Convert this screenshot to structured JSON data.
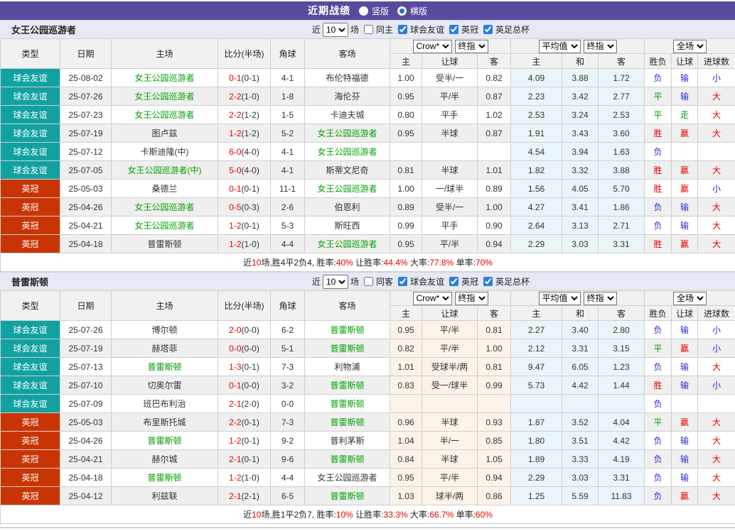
{
  "header": {
    "title": "近期战绩",
    "radios": [
      {
        "label": "竖版",
        "selected": false
      },
      {
        "label": "横版",
        "selected": true
      }
    ]
  },
  "table_header": {
    "cols": [
      "类型",
      "日期",
      "主场",
      "比分(半场)",
      "角球",
      "客场"
    ],
    "group1": {
      "dropdowns": [
        "Crow*",
        "终指"
      ],
      "subcols": [
        "主",
        "让球",
        "客"
      ]
    },
    "group2": {
      "dropdowns": [
        "平均值",
        "终指"
      ],
      "subcols": [
        "主",
        "和",
        "客"
      ]
    },
    "group3": {
      "dropdowns": [
        "全场"
      ],
      "subcols": [
        "胜负",
        "让球",
        "进球数"
      ]
    }
  },
  "colors": {
    "accent_purple": "#5a4a9d",
    "type_friendly": "#12a1a1",
    "type_championship": "#c93502",
    "focal_team_green": "#00a000",
    "score_red": "#e60000",
    "result_red": "#e60000",
    "result_blue": "#2c2cd8",
    "result_green": "#089b08",
    "avg_col_bg": "#eaf5fa",
    "crow_col_bg": "#fcf2e8"
  },
  "sections": [
    {
      "team": "女王公园巡游者",
      "crow_tint": false,
      "filter": {
        "near_label": "近",
        "count": "10",
        "games_label": "场",
        "same_label": "同主",
        "same_checked": false,
        "leagues": [
          {
            "label": "球会友谊",
            "checked": true
          },
          {
            "label": "英冠",
            "checked": true
          },
          {
            "label": "英足总杯",
            "checked": true
          }
        ]
      },
      "rows": [
        [
          "球会友谊",
          "25-08-02",
          "女王公园巡游者",
          1,
          "0-1",
          "(0-1)",
          "4-1",
          "布伦特福德",
          0,
          "1.00",
          "受半/一",
          "0.82",
          "4.09",
          "3.88",
          "1.72",
          "负",
          "输",
          "小"
        ],
        [
          "球会友谊",
          "25-07-26",
          "女王公园巡游者",
          1,
          "2-2",
          "(1-0)",
          "1-8",
          "海伦芬",
          0,
          "0.95",
          "平/半",
          "0.87",
          "2.23",
          "3.42",
          "2.77",
          "平",
          "输",
          "大"
        ],
        [
          "球会友谊",
          "25-07-23",
          "女王公园巡游者",
          1,
          "2-2",
          "(1-2)",
          "1-5",
          "卡迪夫城",
          0,
          "0.80",
          "平手",
          "1.02",
          "2.53",
          "3.24",
          "2.53",
          "平",
          "走",
          "大"
        ],
        [
          "球会友谊",
          "25-07-19",
          "图卢兹",
          0,
          "1-2",
          "(1-2)",
          "5-2",
          "女王公园巡游者",
          1,
          "0.95",
          "半球",
          "0.87",
          "1.91",
          "3.43",
          "3.60",
          "胜",
          "赢",
          "大"
        ],
        [
          "球会友谊",
          "25-07-12",
          "卡斯迪隆(中)",
          0,
          "6-0",
          "(4-0)",
          "4-1",
          "女王公园巡游者",
          1,
          "",
          "",
          "",
          "4.54",
          "3.94",
          "1.63",
          "负",
          "",
          ""
        ],
        [
          "球会友谊",
          "25-07-05",
          "女王公园巡游者(中)",
          1,
          "5-0",
          "(4-0)",
          "4-1",
          "斯蒂文尼奇",
          0,
          "0.81",
          "半球",
          "1.01",
          "1.82",
          "3.32",
          "3.88",
          "胜",
          "赢",
          "大"
        ],
        [
          "英冠",
          "25-05-03",
          "桑德兰",
          0,
          "0-1",
          "(0-1)",
          "11-1",
          "女王公园巡游者",
          1,
          "1.00",
          "一/球半",
          "0.89",
          "1.56",
          "4.05",
          "5.70",
          "胜",
          "赢",
          "小"
        ],
        [
          "英冠",
          "25-04-26",
          "女王公园巡游者",
          1,
          "0-5",
          "(0-3)",
          "2-6",
          "伯恩利",
          0,
          "0.89",
          "受半/一",
          "1.00",
          "4.27",
          "3.41",
          "1.86",
          "负",
          "输",
          "大"
        ],
        [
          "英冠",
          "25-04-21",
          "女王公园巡游者",
          1,
          "1-2",
          "(0-1)",
          "5-3",
          "斯旺西",
          0,
          "0.99",
          "平手",
          "0.90",
          "2.64",
          "3.13",
          "2.71",
          "负",
          "输",
          "大"
        ],
        [
          "英冠",
          "25-04-18",
          "普雷斯顿",
          0,
          "1-2",
          "(1-0)",
          "4-4",
          "女王公园巡游者",
          1,
          "0.95",
          "平/半",
          "0.94",
          "2.29",
          "3.03",
          "3.31",
          "胜",
          "赢",
          "大"
        ]
      ],
      "summary": [
        {
          "text": "近"
        },
        {
          "text": "10",
          "red": true
        },
        {
          "text": "场,胜4平2负4, 胜率:"
        },
        {
          "text": "40%",
          "red": true
        },
        {
          "text": " 让胜率:"
        },
        {
          "text": "44.4%",
          "red": true
        },
        {
          "text": " 大率:"
        },
        {
          "text": "77.8%",
          "red": true
        },
        {
          "text": " 单率:"
        },
        {
          "text": "70%",
          "red": true
        }
      ]
    },
    {
      "team": "普雷斯顿",
      "crow_tint": true,
      "filter": {
        "near_label": "近",
        "count": "10",
        "games_label": "场",
        "same_label": "同客",
        "same_checked": false,
        "leagues": [
          {
            "label": "球会友谊",
            "checked": true
          },
          {
            "label": "英冠",
            "checked": true
          },
          {
            "label": "英足总杯",
            "checked": true
          }
        ]
      },
      "rows": [
        [
          "球会友谊",
          "25-07-26",
          "博尔顿",
          0,
          "2-0",
          "(0-0)",
          "6-2",
          "普雷斯顿",
          1,
          "0.95",
          "平/半",
          "0.81",
          "2.27",
          "3.40",
          "2.80",
          "负",
          "输",
          "小"
        ],
        [
          "球会友谊",
          "25-07-19",
          "赫塔菲",
          0,
          "0-0",
          "(0-0)",
          "5-1",
          "普雷斯顿",
          1,
          "0.82",
          "平/半",
          "1.00",
          "2.12",
          "3.31",
          "3.15",
          "平",
          "赢",
          "小"
        ],
        [
          "球会友谊",
          "25-07-13",
          "普雷斯顿",
          1,
          "1-3",
          "(0-1)",
          "7-3",
          "利物浦",
          0,
          "1.01",
          "受球半/两",
          "0.81",
          "9.47",
          "6.05",
          "1.23",
          "负",
          "输",
          "大"
        ],
        [
          "球会友谊",
          "25-07-10",
          "切奥尔雷",
          0,
          "0-1",
          "(0-0)",
          "3-2",
          "普雷斯顿",
          1,
          "0.83",
          "受一/球半",
          "0.99",
          "5.73",
          "4.42",
          "1.44",
          "胜",
          "输",
          "小"
        ],
        [
          "球会友谊",
          "25-07-09",
          "班巴布利治",
          0,
          "2-1",
          "(2-0)",
          "0-0",
          "普雷斯顿",
          1,
          "",
          "",
          "",
          "",
          "",
          "",
          "负",
          "",
          ""
        ],
        [
          "英冠",
          "25-05-03",
          "布里斯托城",
          0,
          "2-2",
          "(0-1)",
          "7-3",
          "普雷斯顿",
          1,
          "0.96",
          "半球",
          "0.93",
          "1.87",
          "3.52",
          "4.04",
          "平",
          "赢",
          "大"
        ],
        [
          "英冠",
          "25-04-26",
          "普雷斯顿",
          1,
          "1-2",
          "(0-1)",
          "9-2",
          "普利茅斯",
          0,
          "1.04",
          "半/一",
          "0.85",
          "1.80",
          "3.51",
          "4.42",
          "负",
          "输",
          "大"
        ],
        [
          "英冠",
          "25-04-21",
          "赫尔城",
          0,
          "2-1",
          "(0-1)",
          "9-6",
          "普雷斯顿",
          1,
          "0.84",
          "半球",
          "1.05",
          "1.89",
          "3.33",
          "4.19",
          "负",
          "输",
          "大"
        ],
        [
          "英冠",
          "25-04-18",
          "普雷斯顿",
          1,
          "1-2",
          "(1-0)",
          "4-4",
          "女王公园巡游者",
          0,
          "0.95",
          "平/半",
          "0.94",
          "2.29",
          "3.03",
          "3.31",
          "负",
          "输",
          "大"
        ],
        [
          "英冠",
          "25-04-12",
          "利兹联",
          0,
          "2-1",
          "(2-1)",
          "6-5",
          "普雷斯顿",
          1,
          "1.03",
          "球半/两",
          "0.86",
          "1.25",
          "5.59",
          "11.83",
          "负",
          "赢",
          "大"
        ]
      ],
      "summary": [
        {
          "text": "近"
        },
        {
          "text": "10",
          "red": true
        },
        {
          "text": "场,胜1平2负7, 胜率:"
        },
        {
          "text": "10%",
          "red": true
        },
        {
          "text": " 让胜率:"
        },
        {
          "text": "33.3%",
          "red": true
        },
        {
          "text": " 大率:"
        },
        {
          "text": "66.7%",
          "red": true
        },
        {
          "text": " 单率:"
        },
        {
          "text": "60%",
          "red": true
        }
      ]
    }
  ]
}
